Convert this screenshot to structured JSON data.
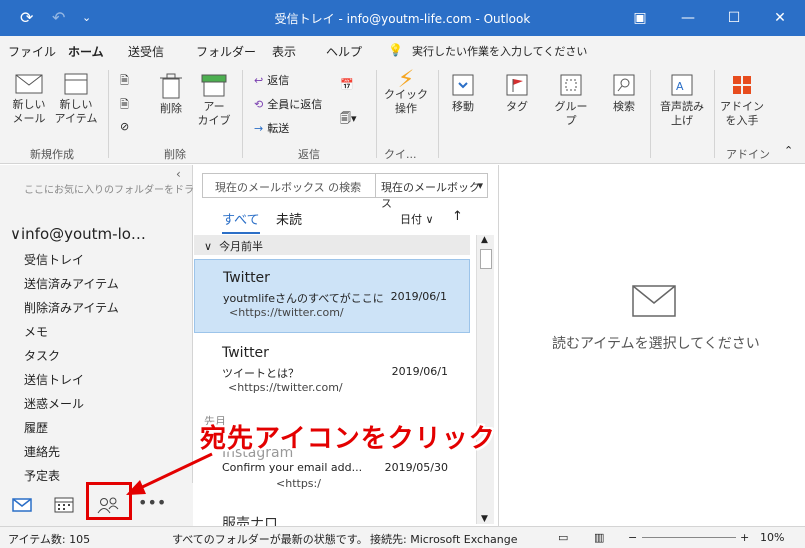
{
  "titlebar": {
    "title": "受信トレイ - info@youtm-life.com  -  Outlook",
    "qa_icons": [
      "sync-icon",
      "undo-icon",
      "customize-icon"
    ],
    "controls": [
      "restore-ribbon-icon",
      "minimize-icon",
      "maximize-icon",
      "close-icon"
    ]
  },
  "menu": {
    "tabs": [
      "ファイル",
      "ホーム",
      "送受信",
      "フォルダー",
      "表示",
      "ヘルプ"
    ],
    "active": "ホーム",
    "tellme": "実行したい作業を入力してください"
  },
  "ribbon": {
    "new_mail": "新しい\nメール",
    "new_items": "新しい\nアイテム",
    "delete": "削除",
    "archive": "アー\nカイブ",
    "reply": "返信",
    "reply_all": "全員に返信",
    "forward": "転送",
    "quick_steps": "クイック\n操作",
    "move": "移動",
    "tags": "タグ",
    "group": "グルー\nプ",
    "search": "検索",
    "read_aloud": "音声読み\n上げ",
    "addins": "アドイン\nを入手",
    "groups": {
      "new": "新規作成",
      "delete": "削除",
      "respond": "返信",
      "quick": "クイ...",
      "addins": "アドイン"
    }
  },
  "folders": {
    "favorites_hint": "ここにお気に入りのフォルダーをドラッ",
    "account": "info@youtm-lo…",
    "items": [
      "受信トレイ",
      "送信済みアイテム",
      "削除済みアイテム",
      "メモ",
      "タスク",
      "送信トレイ",
      "迷惑メール",
      "履歴",
      "連絡先",
      "予定表"
    ]
  },
  "maillist": {
    "search_placeholder": "現在のメールボックス の検索",
    "scope": "現在のメールボックス",
    "filter_all": "すべて",
    "filter_unread": "未読",
    "sort": "日付",
    "group_header": "今月前半",
    "messages": [
      {
        "from": "Twitter",
        "subject": "youtmlifeさんのすべてがここに",
        "date": "2019/06/1",
        "preview": "<https://twitter.com/"
      },
      {
        "from": "Twitter",
        "subject": "ツイートとは？",
        "date": "2019/06/1",
        "preview": "<https://twitter.com/"
      },
      {
        "from": "Instagram",
        "subject": "Confirm your email add...",
        "date": "2019/05/30",
        "preview": "<https:/"
      }
    ],
    "group_header2": "先月",
    "partial_from": "服売ナロ"
  },
  "reading": {
    "empty_text": "読むアイテムを選択してください"
  },
  "status": {
    "items": "アイテム数: 105",
    "sync": "すべてのフォルダーが最新の状態です。",
    "conn": "接続先: Microsoft Exchange",
    "zoom": "10%"
  },
  "annotation": {
    "text": "宛先アイコンをクリック"
  },
  "colors": {
    "accent": "#2b6fc7",
    "highlight": "#e30000",
    "selected_row": "#cde3f7"
  }
}
